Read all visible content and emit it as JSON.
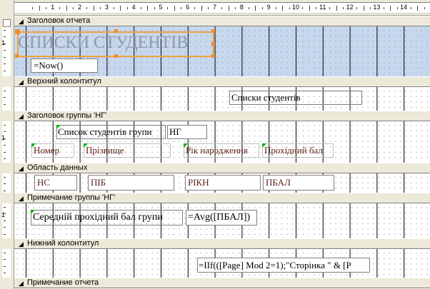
{
  "ruler": {
    "numbers": [
      "1",
      "2",
      "3",
      "4",
      "5",
      "6",
      "7",
      "8",
      "9",
      "10",
      "11",
      "12",
      "13",
      "14",
      "15"
    ],
    "left_numbers": [
      "1",
      "1",
      "1"
    ]
  },
  "sections": {
    "report_header": "Заголовок отчета",
    "page_header": "Верхний колонтитул",
    "group_header": "Заголовок группы 'НГ'",
    "detail": "Область данных",
    "group_footer": "Примечание группы 'НГ'",
    "page_footer": "Нижний колонтитул",
    "report_footer": "Примечание отчета"
  },
  "controls": {
    "title": "СПИСКИ СТУДЕНТІВ",
    "now": "=Now()",
    "page_header_label": "Списки студентів",
    "group_label": "Список студентів групи",
    "group_value": "НГ",
    "col_number": "Номер",
    "col_surname": "Прізвище",
    "col_birth": "Рік народження",
    "col_score": "Прохідний бал",
    "field_nc": "НС",
    "field_pib": "ПІБ",
    "field_rikn": "РІКН",
    "field_pbal": "ПБАЛ",
    "avg_label": "Середній прохідний бал групи",
    "avg_expr": "=Avg([ПБАЛ])",
    "page_expr": "=IIf(([Page] Mod 2=1);\"Сторінка \" & [P"
  },
  "colors": {
    "section_bar": "#ece9d8",
    "report_header_fill": "#c6d7ee",
    "selection": "#f0a040",
    "label_text_dark": "#5a1e14",
    "error_marker": "#00b000"
  }
}
